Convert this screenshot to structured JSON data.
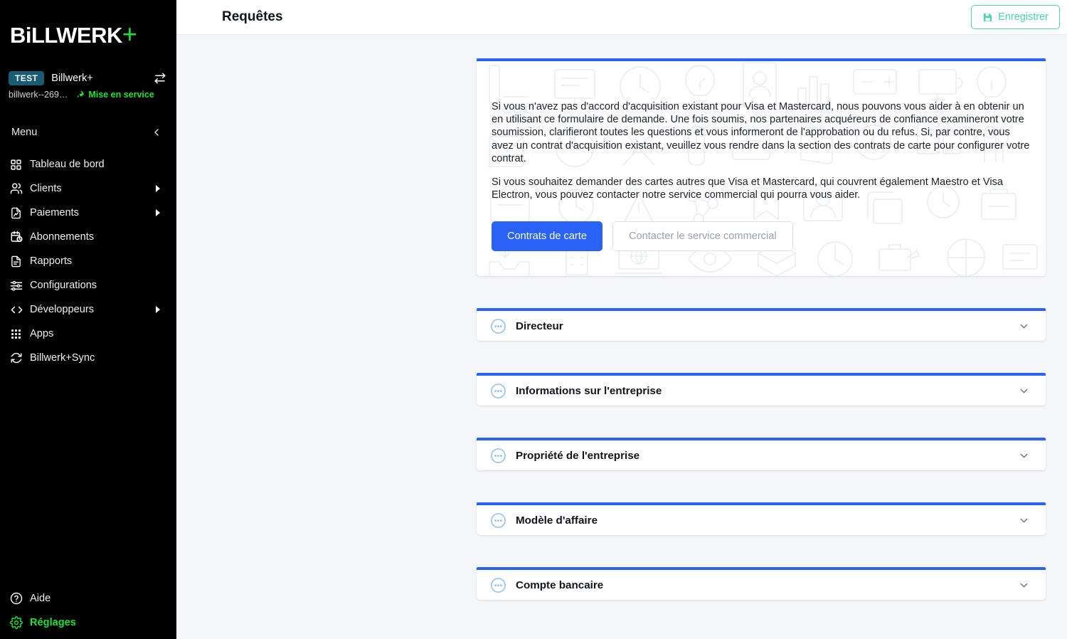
{
  "brand": {
    "logo_text": "BiLLWERK",
    "logo_plus": "+"
  },
  "tenant": {
    "badge": "TEST",
    "name": "Billwerk+",
    "id": "billwerk--269…",
    "status": "Mise en service",
    "swap_icon": "swap-horizontal-icon",
    "rocket_icon": "rocket-icon"
  },
  "sidebar": {
    "menu_label": "Menu",
    "collapse_icon": "chevron-left-icon",
    "items": [
      {
        "label": "Tableau de bord",
        "icon": "dashboard-grid-icon",
        "has_submenu": false
      },
      {
        "label": "Clients",
        "icon": "users-icon",
        "has_submenu": true
      },
      {
        "label": "Paiements",
        "icon": "invoice-icon",
        "has_submenu": true
      },
      {
        "label": "Abonnements",
        "icon": "calendar-clock-icon",
        "has_submenu": false
      },
      {
        "label": "Rapports",
        "icon": "document-icon",
        "has_submenu": false
      },
      {
        "label": "Configurations",
        "icon": "sliders-icon",
        "has_submenu": false
      },
      {
        "label": "Développeurs",
        "icon": "code-brackets-icon",
        "has_submenu": true
      },
      {
        "label": "Apps",
        "icon": "apps-dots-icon",
        "has_submenu": false
      },
      {
        "label": "Billwerk+Sync",
        "icon": "sync-refresh-icon",
        "has_submenu": false
      }
    ],
    "bottom_items": [
      {
        "label": "Aide",
        "icon": "question-circle-icon",
        "active": false
      },
      {
        "label": "Réglages",
        "icon": "gear-icon",
        "active": true
      }
    ]
  },
  "header": {
    "title": "Requêtes",
    "save_label": "Enregistrer",
    "save_icon": "save-disk-icon"
  },
  "intro": {
    "paragraph1": "Si vous n'avez pas d'accord d'acquisition existant pour Visa et Mastercard, nous pouvons vous aider à en obtenir un en utilisant ce formulaire de demande. Une fois soumis, nos partenaires acquéreurs de confiance examineront votre soumission, clarifieront toutes les questions et vous informeront de l'approbation ou du refus. Si, par contre, vous avez un contrat d'acquisition existant, veuillez vous rendre dans la section des contrats de carte pour configurer votre contrat.",
    "paragraph2": "Si vous souhaitez demander des cartes autres que Visa et Mastercard, qui couvrent également Maestro et Visa Electron, vous pouvez contacter notre service commercial qui pourra vous aider.",
    "primary_button": "Contrats de carte",
    "secondary_button": "Contacter le service commercial"
  },
  "sections": [
    {
      "title": "Directeur",
      "icon": "ellipsis-circle-icon",
      "chevron": "chevron-down-icon",
      "expanded": false
    },
    {
      "title": "Informations sur l'entreprise",
      "icon": "ellipsis-circle-icon",
      "chevron": "chevron-down-icon",
      "expanded": false
    },
    {
      "title": "Propriété de l'entreprise",
      "icon": "ellipsis-circle-icon",
      "chevron": "chevron-down-icon",
      "expanded": false
    },
    {
      "title": "Modèle d'affaire",
      "icon": "ellipsis-circle-icon",
      "chevron": "chevron-down-icon",
      "expanded": false
    },
    {
      "title": "Compte bancaire",
      "icon": "ellipsis-circle-icon",
      "chevron": "chevron-down-icon",
      "expanded": false
    }
  ],
  "colors": {
    "sidebar_bg": "#000000",
    "accent_green": "#22e032",
    "accent_blue": "#2962f6",
    "save_teal": "#4ad4ae",
    "test_badge_bg": "#1a5c73",
    "page_bg": "#f4f6f9",
    "card_top_border": "#2962f6"
  }
}
